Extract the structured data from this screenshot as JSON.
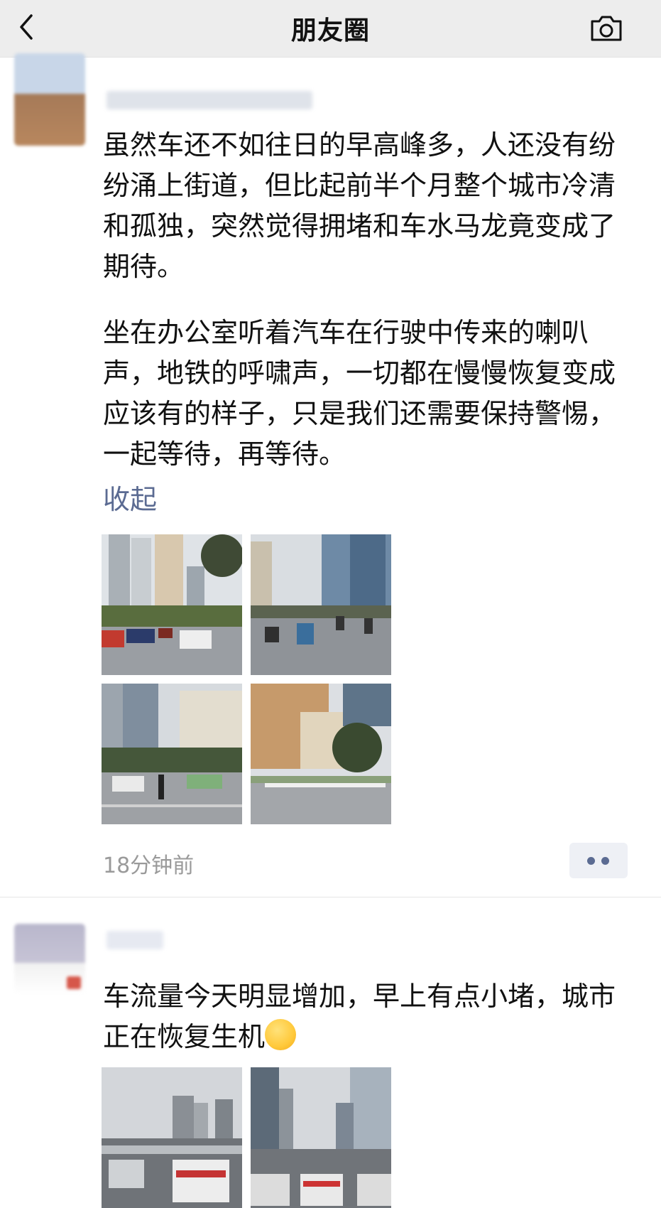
{
  "nav": {
    "title": "朋友圈",
    "back_icon": "chevron-left-icon",
    "camera_icon": "camera-icon"
  },
  "post1": {
    "paragraph1": "虽然车还不如往日的早高峰多，人还没有纷纷涌上街道，但比起前半个月整个城市冷清和孤独，突然觉得拥堵和车水马龙竟变成了期待。",
    "paragraph2": "坐在办公室听着汽车在行驶中传来的喇叭声，地铁的呼啸声，一切都在慢慢恢复变成应该有的样子，只是我们还需要保持警惕，一起等待，再等待。",
    "collapse_label": "收起",
    "photos": [
      "street-photo-1",
      "street-photo-2",
      "street-photo-3",
      "street-photo-4"
    ],
    "time": "18分钟前",
    "more_icon": "more-dots-icon"
  },
  "post2": {
    "text": "车流量今天明显增加，早上有点小堵，城市正在恢复生机",
    "emoji": "wink-tongue-emoji",
    "photos": [
      "traffic-photo-1",
      "traffic-photo-2"
    ]
  },
  "colors": {
    "link": "#5b6b92",
    "nav_bg": "#ededed",
    "time": "#9a9a9a"
  }
}
